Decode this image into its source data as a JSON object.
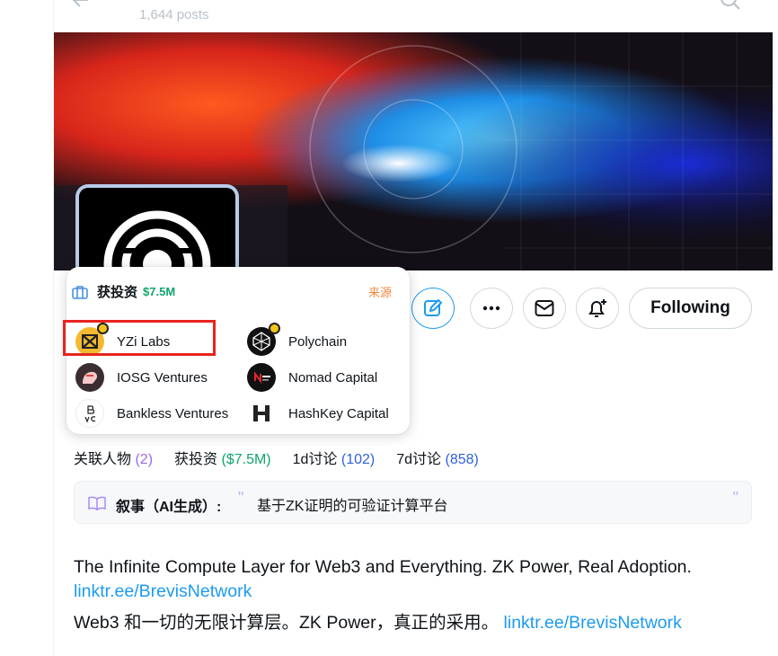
{
  "header": {
    "post_count": "1,644 posts"
  },
  "profile": {
    "following_label": "Following",
    "bio": "The Infinite Compute Layer for Web3 and Everything. ZK Power, Real Adoption.",
    "bio_link": "linktr.ee/BrevisNetwork",
    "bio_translated": "Web3 和一切的无限计算层。ZK Power，真正的采用。",
    "bio_translated_link": "linktr.ee/BrevisNetwork"
  },
  "funding_popup": {
    "title": "获投资",
    "amount": "$7.5M",
    "source_label": "来源",
    "investors": [
      {
        "name": "YZi Labs",
        "logo": "yzi-labs-logo"
      },
      {
        "name": "Polychain",
        "logo": "polychain-logo"
      },
      {
        "name": "IOSG Ventures",
        "logo": "iosg-logo"
      },
      {
        "name": "Nomad Capital",
        "logo": "nomad-capital-logo"
      },
      {
        "name": "Bankless Ventures",
        "logo": "bankless-logo"
      },
      {
        "name": "HashKey Capital",
        "logo": "hashkey-logo"
      }
    ]
  },
  "tabs": [
    {
      "label": "关联人物",
      "count": "(2)"
    },
    {
      "label": "获投资",
      "count": "($7.5M)"
    },
    {
      "label": "1d讨论",
      "count": "(102)"
    },
    {
      "label": "7d讨论",
      "count": "(858)"
    }
  ],
  "narrative": {
    "label": "叙事（AI生成）:",
    "open_quote": "\"",
    "text": "基于ZK证明的可验证计算平台",
    "close_quote": "\""
  },
  "colors": {
    "accent_blue": "#1d9bf0",
    "green": "#10a56b",
    "orange": "#f0883e",
    "highlight_red": "#e8241f"
  }
}
